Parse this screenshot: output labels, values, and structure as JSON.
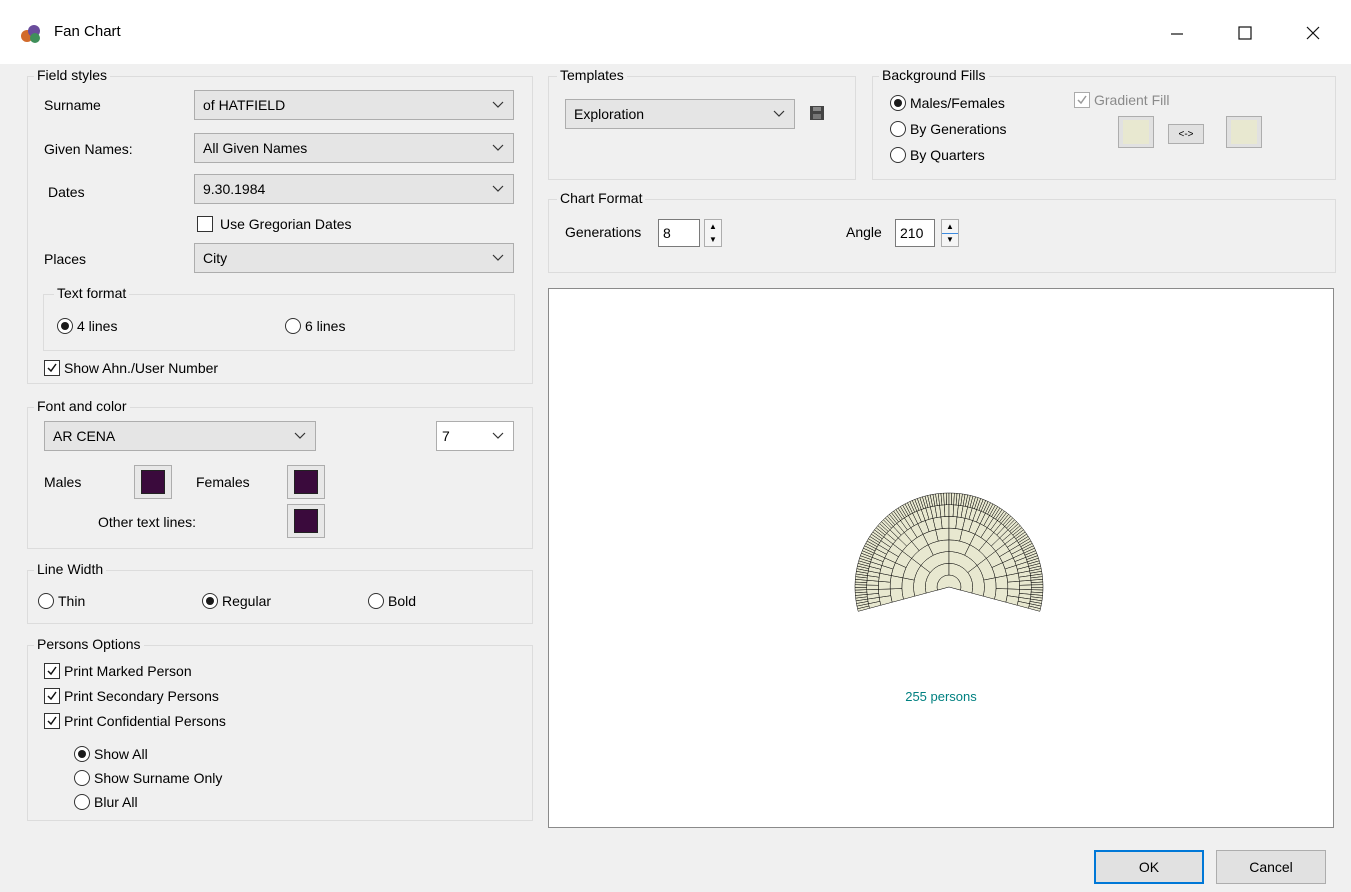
{
  "window": {
    "title": "Fan Chart",
    "min_icon": "minimize-icon",
    "max_icon": "maximize-icon",
    "close_icon": "close-icon"
  },
  "field_styles": {
    "legend": "Field styles",
    "surname_label": "Surname",
    "surname_value": "of HATFIELD",
    "given_label": "Given Names:",
    "given_value": "All Given Names",
    "dates_label": "Dates",
    "dates_value": "9.30.1984",
    "gregorian_label": "Use Gregorian Dates",
    "gregorian_checked": false,
    "places_label": "Places",
    "places_value": "City",
    "text_format": {
      "legend": "Text format",
      "opt4": "4 lines",
      "opt6": "6 lines",
      "selected": "4 lines"
    },
    "show_ahn_label": "Show Ahn./User Number",
    "show_ahn_checked": true
  },
  "font_color": {
    "legend": "Font and color",
    "font_value": "AR CENA",
    "size_value": "7",
    "males_label": "Males",
    "females_label": "Females",
    "other_label": "Other text lines:",
    "swatch_color": "#3a0a3c"
  },
  "line_width": {
    "legend": "Line Width",
    "thin": "Thin",
    "regular": "Regular",
    "bold": "Bold",
    "selected": "Regular"
  },
  "persons_options": {
    "legend": "Persons Options",
    "marked": "Print Marked Person",
    "secondary": "Print Secondary Persons",
    "confidential": "Print Confidential Persons",
    "show_all": "Show All",
    "surname_only": "Show Surname Only",
    "blur_all": "Blur All",
    "selected": "Show All"
  },
  "templates": {
    "legend": "Templates",
    "value": "Exploration",
    "save_icon": "save-icon"
  },
  "background_fills": {
    "legend": "Background Fills",
    "males_females": "Males/Females",
    "by_generations": "By Generations",
    "by_quarters": "By Quarters",
    "selected": "Males/Females",
    "gradient_label": "Gradient Fill",
    "gradient_checked": true,
    "swap_label": "<->",
    "fill_color": "#e8e8d0"
  },
  "chart_format": {
    "legend": "Chart Format",
    "generations_label": "Generations",
    "generations_value": "8",
    "angle_label": "Angle",
    "angle_value": "210"
  },
  "preview": {
    "persons_text": "255 persons",
    "fan_fill": "#e8e8d0",
    "text_color": "#008080"
  },
  "buttons": {
    "ok": "OK",
    "cancel": "Cancel"
  }
}
